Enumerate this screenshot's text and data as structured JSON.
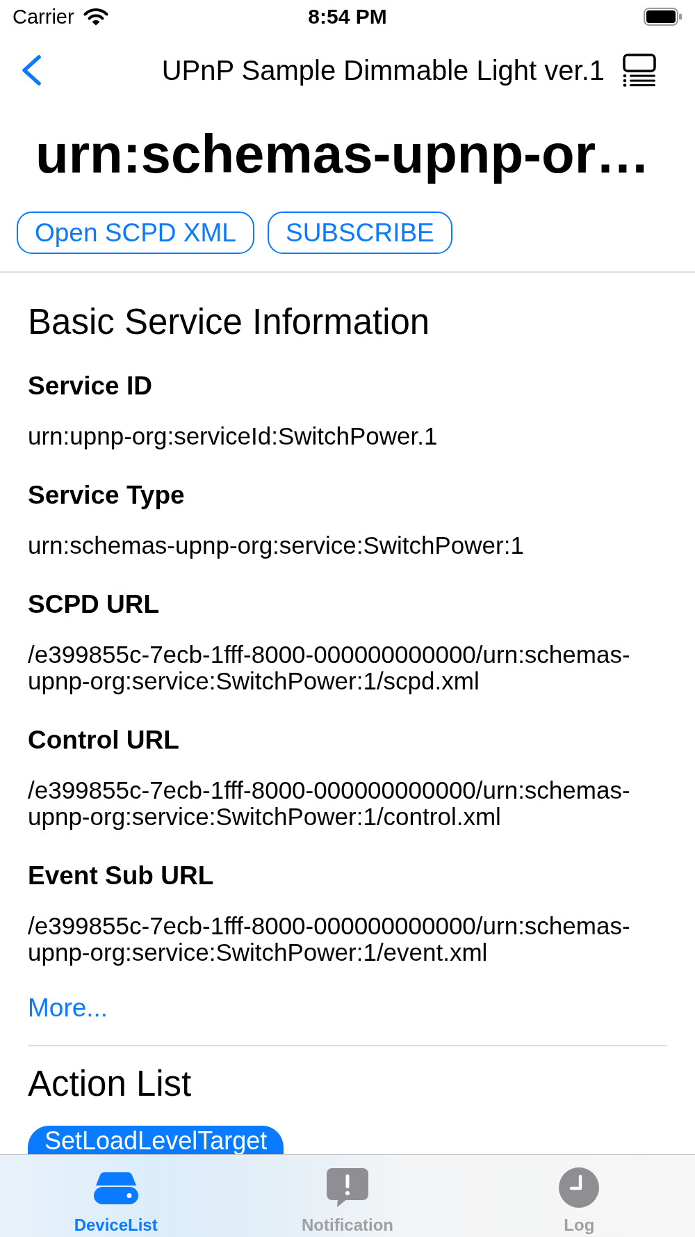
{
  "status_bar": {
    "carrier": "Carrier",
    "time": "8:54 PM"
  },
  "nav_bar": {
    "title": "UPnP Sample Dimmable Light ver.1"
  },
  "page_title": "urn:schemas-upnp-or…",
  "buttons": [
    "Open SCPD XML",
    "SUBSCRIBE"
  ],
  "basic_info": {
    "heading": "Basic Service Information",
    "fields": [
      {
        "label": "Service ID",
        "value": "urn:upnp-org:serviceId:SwitchPower.1"
      },
      {
        "label": "Service Type",
        "value": "urn:schemas-upnp-org:service:SwitchPower:1"
      },
      {
        "label": "SCPD URL",
        "value": "/e399855c-7ecb-1fff-8000-000000000000/urn:schemas-upnp-org:service:SwitchPower:1/scpd.xml"
      },
      {
        "label": "Control URL",
        "value": "/e399855c-7ecb-1fff-8000-000000000000/urn:schemas-upnp-org:service:SwitchPower:1/control.xml"
      },
      {
        "label": "Event Sub URL",
        "value": "/e399855c-7ecb-1fff-8000-000000000000/urn:schemas-upnp-org:service:SwitchPower:1/event.xml"
      }
    ],
    "more_link": "More..."
  },
  "action_list": {
    "heading": "Action List",
    "actions": [
      "SetLoadLevelTarget"
    ]
  },
  "tab_bar": [
    {
      "label": "DeviceList",
      "selected": true
    },
    {
      "label": "Notification",
      "selected": false
    },
    {
      "label": "Log",
      "selected": false
    }
  ]
}
